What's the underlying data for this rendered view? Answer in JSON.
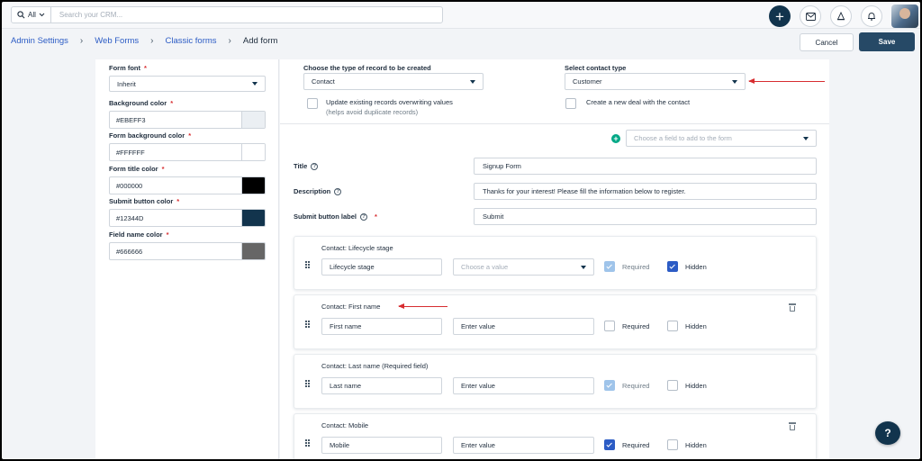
{
  "topbar": {
    "scope_label": "All",
    "search_placeholder": "Search your CRM..."
  },
  "breadcrumb": {
    "items": [
      "Admin Settings",
      "Web Forms",
      "Classic forms"
    ],
    "current": "Add form"
  },
  "actions": {
    "cancel": "Cancel",
    "save": "Save"
  },
  "style_panel": {
    "form_font": {
      "label": "Form font",
      "value": "Inherit"
    },
    "background_color": {
      "label": "Background color",
      "value": "#EBEFF3",
      "swatch": "#EBEFF3"
    },
    "form_background_color": {
      "label": "Form background color",
      "value": "#FFFFFF",
      "swatch": "#FFFFFF"
    },
    "form_title_color": {
      "label": "Form title color",
      "value": "#000000",
      "swatch": "#000000"
    },
    "submit_button_color": {
      "label": "Submit button color",
      "value": "#12344D",
      "swatch": "#12344D"
    },
    "field_name_color": {
      "label": "Field name color",
      "value": "#666666",
      "swatch": "#666666"
    }
  },
  "record_settings": {
    "record_type_label": "Choose the type of record to be created",
    "record_type_value": "Contact",
    "contact_type_label": "Select contact type",
    "contact_type_value": "Customer",
    "update_existing_label": "Update existing records overwriting values",
    "update_existing_note": "(helps avoid duplicate records)",
    "update_existing_checked": false,
    "create_deal_label": "Create a new deal with the contact",
    "create_deal_checked": false
  },
  "field_picker": {
    "placeholder": "Choose a field to add to the form"
  },
  "form_settings": {
    "title_label": "Title",
    "title_value": "Signup Form",
    "description_label": "Description",
    "description_value": "Thanks for your interest! Please fill the information below to register.",
    "submit_label": "Submit button label",
    "submit_value": "Submit"
  },
  "field_cards": [
    {
      "title": "Contact: Lifecycle stage",
      "name": "Lifecycle stage",
      "value_placeholder": "Choose a value",
      "required_label": "Required",
      "hidden_label": "Hidden",
      "required": true,
      "required_locked": true,
      "hidden": true
    },
    {
      "title": "Contact: First name",
      "name": "First name",
      "value_placeholder": "Enter value",
      "required_label": "Required",
      "hidden_label": "Hidden",
      "required": false,
      "hidden": false
    },
    {
      "title": "Contact: Last name (Required field)",
      "name": "Last name",
      "value_placeholder": "Enter value",
      "required_label": "Required",
      "hidden_label": "Hidden",
      "required": true,
      "required_locked": true,
      "hidden": false
    },
    {
      "title": "Contact: Mobile",
      "name": "Mobile",
      "value_placeholder": "Enter value",
      "required_label": "Required",
      "hidden_label": "Hidden",
      "required": true,
      "hidden": false
    }
  ],
  "help_button": "?",
  "colors": {
    "primary": "#12344D",
    "save_button": "#264966",
    "link": "#2C5CC5",
    "annotation_arrow": "#D72D30",
    "add_green": "#00A886"
  }
}
